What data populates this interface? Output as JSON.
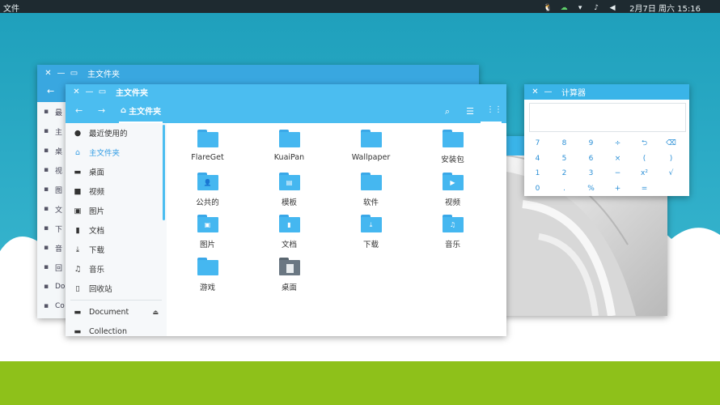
{
  "topbar": {
    "app_name": "文件",
    "clock": "2月7日 周六 15:16"
  },
  "back_window": {
    "title": "主文件夹",
    "sidebar_items": [
      {
        "icon": "clock-icon",
        "label": "最"
      },
      {
        "icon": "home-icon",
        "label": "主"
      },
      {
        "icon": "desktop-icon",
        "label": "桌"
      },
      {
        "icon": "video-icon",
        "label": "视"
      },
      {
        "icon": "picture-icon",
        "label": "图"
      },
      {
        "icon": "document-icon",
        "label": "文"
      },
      {
        "icon": "download-icon",
        "label": "下"
      },
      {
        "icon": "music-icon",
        "label": "音"
      },
      {
        "icon": "trash-icon",
        "label": "回"
      },
      {
        "icon": "drive-icon",
        "label": "Do"
      },
      {
        "icon": "drive-icon",
        "label": "Co"
      }
    ]
  },
  "calculator": {
    "title": "计算器",
    "display": "",
    "keys": [
      [
        "7",
        "8",
        "9",
        "÷",
        "⮌",
        "⌫"
      ],
      [
        "4",
        "5",
        "6",
        "×",
        "(",
        ")"
      ],
      [
        "1",
        "2",
        "3",
        "−",
        "x²",
        "√"
      ],
      [
        "0",
        ".",
        "%",
        "+",
        "=",
        ""
      ]
    ]
  },
  "file_manager": {
    "title": "主文件夹",
    "breadcrumb": "主文件夹",
    "sidebar_items": [
      {
        "name": "sidebar-item-recent",
        "icon": "clock-icon",
        "glyph": "●",
        "label": "最近使用的",
        "active": false
      },
      {
        "name": "sidebar-item-home",
        "icon": "home-icon",
        "glyph": "⌂",
        "label": "主文件夹",
        "active": true
      },
      {
        "name": "sidebar-item-desktop",
        "icon": "desktop-icon",
        "glyph": "▬",
        "label": "桌面",
        "active": false
      },
      {
        "name": "sidebar-item-videos",
        "icon": "video-icon",
        "glyph": "■",
        "label": "视频",
        "active": false
      },
      {
        "name": "sidebar-item-pictures",
        "icon": "picture-icon",
        "glyph": "▣",
        "label": "图片",
        "active": false
      },
      {
        "name": "sidebar-item-documents",
        "icon": "document-icon",
        "glyph": "▮",
        "label": "文档",
        "active": false
      },
      {
        "name": "sidebar-item-downloads",
        "icon": "download-icon",
        "glyph": "⤓",
        "label": "下载",
        "active": false
      },
      {
        "name": "sidebar-item-music",
        "icon": "music-icon",
        "glyph": "♫",
        "label": "音乐",
        "active": false
      },
      {
        "name": "sidebar-item-trash",
        "icon": "trash-icon",
        "glyph": "▯",
        "label": "回收站",
        "active": false
      }
    ],
    "devices": [
      {
        "name": "sidebar-item-document-drive",
        "icon": "drive-icon",
        "label": "Document",
        "eject": true
      },
      {
        "name": "sidebar-item-collection-drive",
        "icon": "drive-icon",
        "label": "Collection",
        "eject": false
      }
    ],
    "files": [
      {
        "label": "FlareGet",
        "emblem": ""
      },
      {
        "label": "KuaiPan",
        "emblem": ""
      },
      {
        "label": "Wallpaper",
        "emblem": ""
      },
      {
        "label": "安装包",
        "emblem": ""
      },
      {
        "label": "公共的",
        "emblem": "👤"
      },
      {
        "label": "模板",
        "emblem": "▤"
      },
      {
        "label": "软件",
        "emblem": ""
      },
      {
        "label": "视频",
        "emblem": "▶"
      },
      {
        "label": "图片",
        "emblem": "▣"
      },
      {
        "label": "文档",
        "emblem": "▮"
      },
      {
        "label": "下载",
        "emblem": "⤓"
      },
      {
        "label": "音乐",
        "emblem": "♫"
      },
      {
        "label": "游戏",
        "emblem": ""
      },
      {
        "label": "桌面",
        "emblem": "desktop"
      }
    ]
  }
}
